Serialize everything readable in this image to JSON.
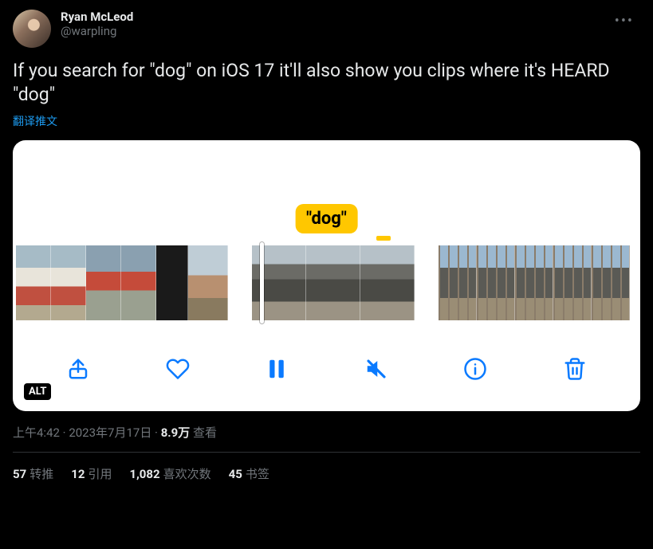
{
  "author": {
    "display_name": "Ryan McLeod",
    "handle": "@warpling"
  },
  "tweet_text": "If you search for \"dog\" on iOS 17 it'll also show you clips where it's HEARD \"dog\"",
  "translate_label": "翻译推文",
  "media": {
    "search_tag": "\"dog\"",
    "alt_badge": "ALT"
  },
  "meta": {
    "time": "上午4:42",
    "date": "2023年7月17日",
    "views_number": "8.9万",
    "views_label": "查看",
    "separator": " · "
  },
  "stats": {
    "retweets_num": "57",
    "retweets_label": "转推",
    "quotes_num": "12",
    "quotes_label": "引用",
    "likes_num": "1,082",
    "likes_label": "喜欢次数",
    "bookmarks_num": "45",
    "bookmarks_label": "书签"
  }
}
